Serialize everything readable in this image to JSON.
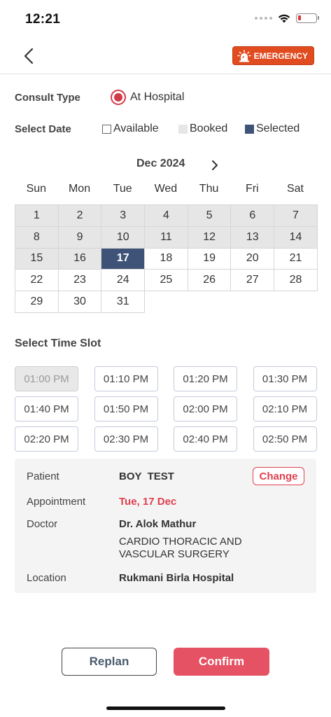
{
  "status": {
    "time": "12:21"
  },
  "header": {
    "emergency_label": "EMERGENCY"
  },
  "consult": {
    "label": "Consult Type",
    "option": "At Hospital"
  },
  "date_select": {
    "label": "Select Date",
    "legend": {
      "available": "Available",
      "booked": "Booked",
      "selected": "Selected"
    }
  },
  "calendar": {
    "month": "Dec 2024",
    "weekdays": [
      "Sun",
      "Mon",
      "Tue",
      "Wed",
      "Thu",
      "Fri",
      "Sat"
    ],
    "days": [
      {
        "n": "1",
        "state": "booked"
      },
      {
        "n": "2",
        "state": "booked"
      },
      {
        "n": "3",
        "state": "booked"
      },
      {
        "n": "4",
        "state": "booked"
      },
      {
        "n": "5",
        "state": "booked"
      },
      {
        "n": "6",
        "state": "booked"
      },
      {
        "n": "7",
        "state": "booked"
      },
      {
        "n": "8",
        "state": "booked"
      },
      {
        "n": "9",
        "state": "booked"
      },
      {
        "n": "10",
        "state": "booked"
      },
      {
        "n": "11",
        "state": "booked"
      },
      {
        "n": "12",
        "state": "booked"
      },
      {
        "n": "13",
        "state": "booked"
      },
      {
        "n": "14",
        "state": "booked"
      },
      {
        "n": "15",
        "state": "booked"
      },
      {
        "n": "16",
        "state": "booked"
      },
      {
        "n": "17",
        "state": "selected"
      },
      {
        "n": "18",
        "state": "available"
      },
      {
        "n": "19",
        "state": "available"
      },
      {
        "n": "20",
        "state": "available"
      },
      {
        "n": "21",
        "state": "available"
      },
      {
        "n": "22",
        "state": "available"
      },
      {
        "n": "23",
        "state": "available"
      },
      {
        "n": "24",
        "state": "available"
      },
      {
        "n": "25",
        "state": "available"
      },
      {
        "n": "26",
        "state": "available"
      },
      {
        "n": "27",
        "state": "available"
      },
      {
        "n": "28",
        "state": "available"
      },
      {
        "n": "29",
        "state": "available"
      },
      {
        "n": "30",
        "state": "available"
      },
      {
        "n": "31",
        "state": "available"
      }
    ]
  },
  "time_slots": {
    "label": "Select Time Slot",
    "slots": [
      {
        "t": "01:00 PM",
        "disabled": true
      },
      {
        "t": "01:10 PM",
        "disabled": false
      },
      {
        "t": "01:20 PM",
        "disabled": false
      },
      {
        "t": "01:30 PM",
        "disabled": false
      },
      {
        "t": "01:40 PM",
        "disabled": false
      },
      {
        "t": "01:50 PM",
        "disabled": false
      },
      {
        "t": "02:00 PM",
        "disabled": false
      },
      {
        "t": "02:10 PM",
        "disabled": false
      },
      {
        "t": "02:20 PM",
        "disabled": false
      },
      {
        "t": "02:30 PM",
        "disabled": false
      },
      {
        "t": "02:40 PM",
        "disabled": false
      },
      {
        "t": "02:50 PM",
        "disabled": false
      }
    ]
  },
  "summary": {
    "patient_label": "Patient",
    "patient_value": "BOY  TEST",
    "change_label": "Change",
    "appointment_label": "Appointment",
    "appointment_value": "Tue, 17 Dec",
    "doctor_label": "Doctor",
    "doctor_name": "Dr. Alok Mathur",
    "doctor_dept": "CARDIO THORACIC AND VASCULAR SURGERY",
    "location_label": "Location",
    "location_value": "Rukmani Birla Hospital"
  },
  "actions": {
    "replan": "Replan",
    "confirm": "Confirm"
  },
  "colors": {
    "selected": "#3e5377",
    "accent": "#e45263",
    "emergency": "#e04b1f",
    "booked": "#e6e6e6"
  }
}
